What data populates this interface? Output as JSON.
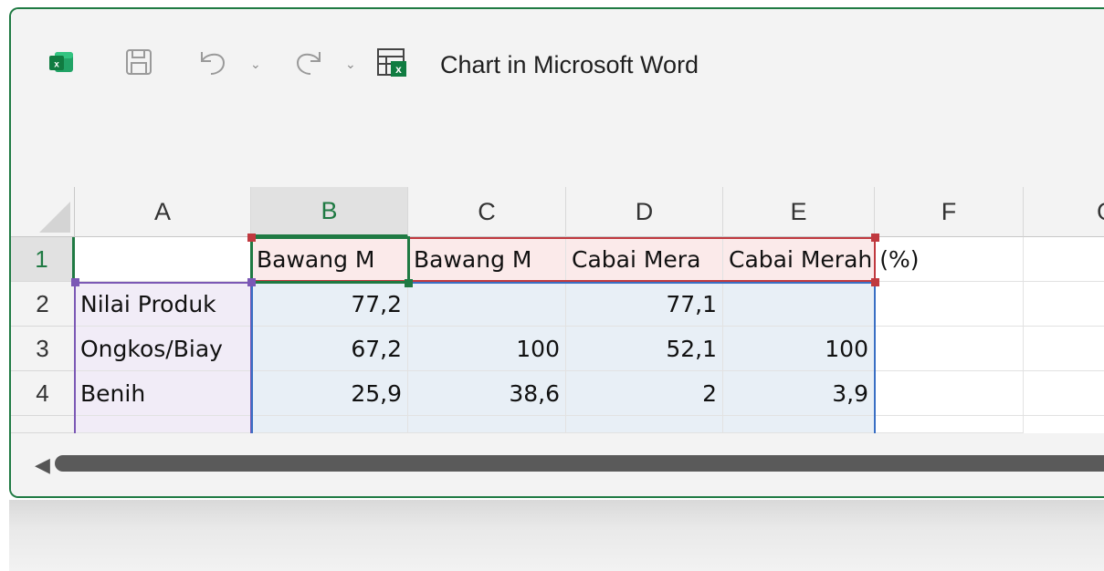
{
  "window": {
    "title": "Chart in Microsoft Word",
    "accent_color": "#1f7a43",
    "app_icon": "excel-icon"
  },
  "toolbar": {
    "save_icon": "save-icon",
    "undo_icon": "undo-icon",
    "redo_icon": "redo-icon",
    "edit_data_icon": "edit-data-in-excel-icon"
  },
  "columns": [
    "A",
    "B",
    "C",
    "D",
    "E",
    "F",
    "G"
  ],
  "rows": [
    "1",
    "2",
    "3",
    "4"
  ],
  "cells": {
    "A1": "",
    "B1": "Bawang M",
    "C1": "Bawang M",
    "D1": "Cabai Mera",
    "E1": "Cabai Merah (%)",
    "A2": "Nilai Produk",
    "B2": "77,2",
    "C2": "",
    "D2": "77,1",
    "E2": "",
    "A3": "Ongkos/Biay",
    "B3": "67,2",
    "C3": "100",
    "D3": "52,1",
    "E3": "100",
    "A4": "Benih",
    "B4": "25,9",
    "C4": "38,6",
    "D4": "2",
    "E4": "3,9"
  },
  "range_colors": {
    "series": "#c0393f",
    "categories": "#7b58b5",
    "values": "#3a6fc4",
    "active": "#1f7a43"
  }
}
